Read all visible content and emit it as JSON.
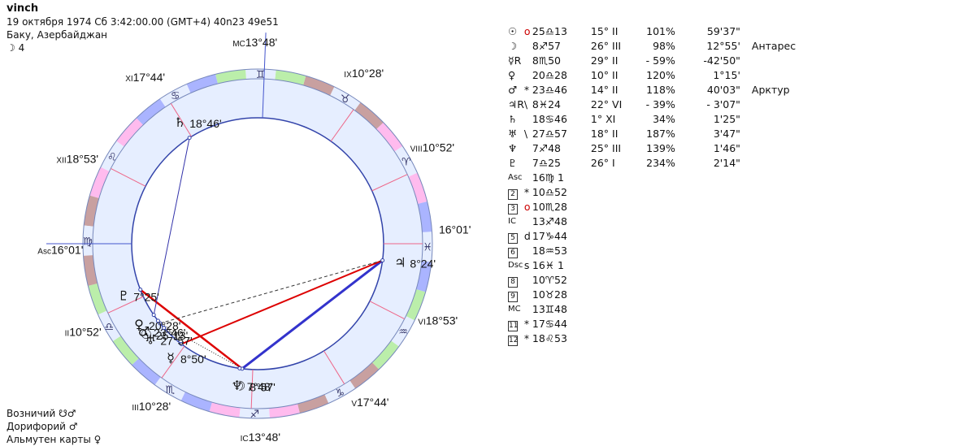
{
  "header": {
    "name": "vinch",
    "datetime": "19 октября 1974  Сб   3:42:00.00 (GMT+4) 40n23  49e51",
    "place": "Баку, Азербайджан",
    "moon_phase": "☽  4"
  },
  "footer": {
    "row1": "Возничий ☋♂",
    "row2": "Дорифорий  ♂",
    "row3": "Альмутен карты  ♀"
  },
  "colors": {
    "fire": "#ffbbee",
    "earth": "#c8a0a0",
    "air": "#bbeeaa",
    "water": "#aab4ff",
    "ring_bg": "#e6eeff",
    "red_aspect": "#dd0000",
    "blue_aspect": "#3333cc"
  },
  "wheel": {
    "ascendant_lon": 166.02,
    "signs": [
      "♈",
      "♉",
      "♊",
      "♋",
      "♌",
      "♍",
      "♎",
      "♏",
      "♐",
      "♑",
      "♒",
      "♓"
    ],
    "houses": [
      {
        "num": "Asc",
        "lon": 166.02,
        "label": "16°01'"
      },
      {
        "num": "II",
        "lon": 190.87,
        "label": "10°52'"
      },
      {
        "num": "III",
        "lon": 220.47,
        "label": "10°28'"
      },
      {
        "num": "IC",
        "lon": 253.8,
        "label": "13°48'"
      },
      {
        "num": "V",
        "lon": 287.73,
        "label": "17°44'"
      },
      {
        "num": "VI",
        "lon": 318.88,
        "label": "18°53'"
      },
      {
        "num": "",
        "lon": 346.02,
        "label": "16°01'"
      },
      {
        "num": "VIII",
        "lon": 10.87,
        "label": "10°52'"
      },
      {
        "num": "IX",
        "lon": 40.47,
        "label": "10°28'"
      },
      {
        "num": "MC",
        "lon": 73.8,
        "label": "13°48'"
      },
      {
        "num": "XI",
        "lon": 107.73,
        "label": "17°44'"
      },
      {
        "num": "XII",
        "lon": 138.88,
        "label": "18°53'"
      }
    ],
    "planets": [
      {
        "glyph": "☉",
        "lon": 205.22,
        "label": "25°13'",
        "retro": false
      },
      {
        "glyph": "☽",
        "lon": 248.95,
        "label": "8°57'",
        "retro": false
      },
      {
        "glyph": "☿",
        "lon": 218.83,
        "label": "8°50'",
        "retro": true
      },
      {
        "glyph": "♀",
        "lon": 200.47,
        "label": "20°28'",
        "retro": false
      },
      {
        "glyph": "♂",
        "lon": 203.77,
        "label": "23°46'",
        "retro": false
      },
      {
        "glyph": "♃",
        "lon": 338.4,
        "label": "8°24'",
        "retro": true
      },
      {
        "glyph": "♄",
        "lon": 108.77,
        "label": "18°46'",
        "retro": false
      },
      {
        "glyph": "♅",
        "lon": 207.95,
        "label": "27°57'",
        "retro": false
      },
      {
        "glyph": "♆",
        "lon": 247.8,
        "label": "7°48'",
        "retro": false
      },
      {
        "glyph": "♇",
        "lon": 187.42,
        "label": "7°25'",
        "retro": false
      }
    ]
  },
  "table": {
    "planets": [
      {
        "glyph": "☉",
        "flag": "о",
        "flag_red": true,
        "pos": "25♎13",
        "house": "15° II",
        "strength": "101%",
        "speed": "59'37\"",
        "star": ""
      },
      {
        "glyph": "☽",
        "flag": "",
        "flag_red": false,
        "pos": " 8♐57",
        "house": "26° III",
        "strength": "98%",
        "speed": "12°55'",
        "star": "Антарес"
      },
      {
        "glyph": "☿R",
        "flag": "",
        "flag_red": false,
        "pos": " 8♏50",
        "house": "29° II",
        "strength": "- 59%",
        "speed": "-42'50\"",
        "star": ""
      },
      {
        "glyph": "♀",
        "flag": "",
        "flag_red": false,
        "pos": "20♎28",
        "house": "10° II",
        "strength": "120%",
        "speed": "1°15'",
        "star": ""
      },
      {
        "glyph": "♂",
        "flag": "*",
        "flag_red": false,
        "pos": "23♎46",
        "house": "14° II",
        "strength": "118%",
        "speed": "40'03\"",
        "star": "Арктур"
      },
      {
        "glyph": "♃R",
        "flag": "\\",
        "flag_red": false,
        "pos": " 8♓24",
        "house": "22° VI",
        "strength": "- 39%",
        "speed": "- 3'07\"",
        "star": ""
      },
      {
        "glyph": "♄",
        "flag": "",
        "flag_red": false,
        "pos": "18♋46",
        "house": "1° XI",
        "strength": "34%",
        "speed": "1'25\"",
        "star": ""
      },
      {
        "glyph": "♅",
        "flag": "\\",
        "flag_red": false,
        "pos": "27♎57",
        "house": "18° II",
        "strength": "187%",
        "speed": "3'47\"",
        "star": ""
      },
      {
        "glyph": "♆",
        "flag": "",
        "flag_red": false,
        "pos": " 7♐48",
        "house": "25° III",
        "strength": "139%",
        "speed": "1'46\"",
        "star": ""
      },
      {
        "glyph": "♇",
        "flag": "",
        "flag_red": false,
        "pos": " 7♎25",
        "house": "26° I",
        "strength": "234%",
        "speed": "2'14\"",
        "star": ""
      }
    ],
    "cusps": [
      {
        "label": "Asc",
        "boxed": false,
        "flag": "",
        "flag_red": false,
        "pos": "16♍ 1"
      },
      {
        "label": "2",
        "boxed": true,
        "flag": "*",
        "flag_red": false,
        "pos": "10♎52"
      },
      {
        "label": "3",
        "boxed": true,
        "flag": "о",
        "flag_red": true,
        "pos": "10♏28"
      },
      {
        "label": "IC",
        "boxed": false,
        "flag": "",
        "flag_red": false,
        "pos": "13♐48"
      },
      {
        "label": "5",
        "boxed": true,
        "flag": "d",
        "flag_red": false,
        "pos": "17♑44"
      },
      {
        "label": "6",
        "boxed": true,
        "flag": "",
        "flag_red": false,
        "pos": "18♒53"
      },
      {
        "label": "Dsc",
        "boxed": false,
        "flag": "s",
        "flag_red": false,
        "pos": "16♓ 1"
      },
      {
        "label": "8",
        "boxed": true,
        "flag": "",
        "flag_red": false,
        "pos": "10♈52"
      },
      {
        "label": "9",
        "boxed": true,
        "flag": "",
        "flag_red": false,
        "pos": "10♉28"
      },
      {
        "label": "MC",
        "boxed": false,
        "flag": "",
        "flag_red": false,
        "pos": "13♊48"
      },
      {
        "label": "11",
        "boxed": true,
        "flag": "*",
        "flag_red": false,
        "pos": "17♋44"
      },
      {
        "label": "12",
        "boxed": true,
        "flag": "*",
        "flag_red": false,
        "pos": "18♌53"
      }
    ]
  }
}
